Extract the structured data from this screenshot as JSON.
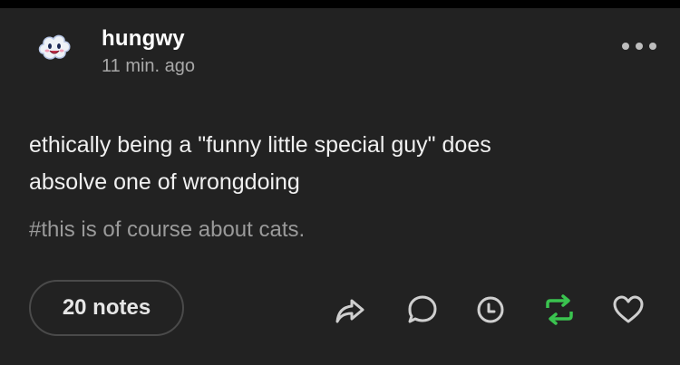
{
  "post": {
    "username": "hungwy",
    "timestamp": "11 min. ago",
    "body_line1": "ethically being a \"funny little special guy\" does",
    "body_line2": "absolve one of wrongdoing",
    "tags": "#this is of course about cats.",
    "notes_label": "20 notes"
  },
  "icons": {
    "avatar": "cloud-face-avatar",
    "more": "more-options-icon",
    "share": "share-icon",
    "reply": "reply-icon",
    "schedule": "clock-icon",
    "reblog": "reblog-icon",
    "like": "heart-icon"
  },
  "colors": {
    "background": "#222222",
    "reblog_accent": "#3ac34f",
    "muted_text": "#a8a8a8"
  }
}
